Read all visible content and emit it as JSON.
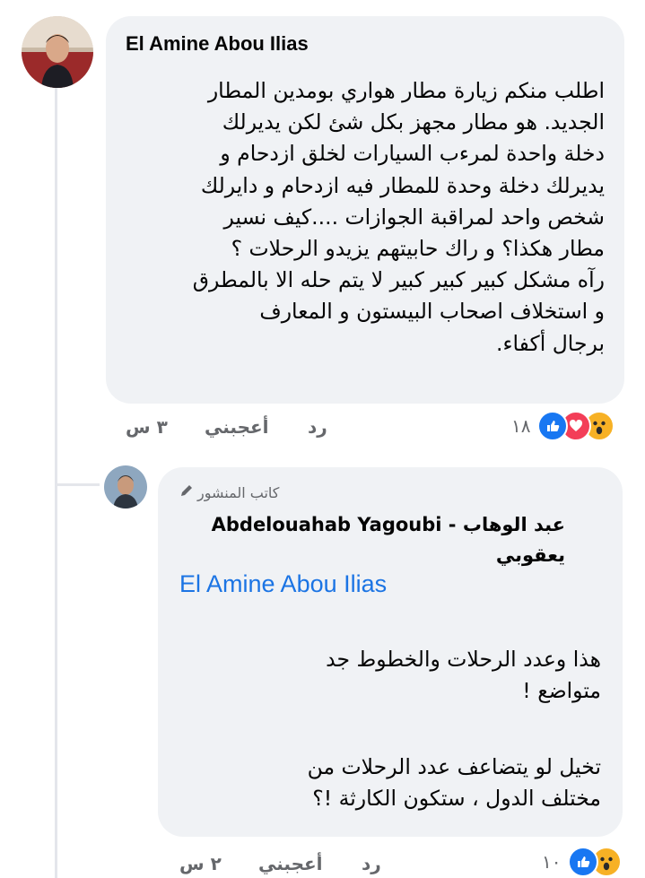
{
  "comment": {
    "author": "El Amine Abou Ilias",
    "text_lines": [
      "اطلب منكم زيارة مطار هواري بومدين المطار",
      "الجديد. هو مطار مجهز بكل شئ لكن يديرلك",
      "دخلة واحدة لمرءب السيارات لخلق ازدحام و",
      "يديرلك دخلة وحدة للمطار فيه ازدحام و دايرلك",
      "شخص واحد لمراقبة الجوازات ....كيف نسير",
      "مطار هكذا؟ و راك حابيتهم يزيدو الرحلات ؟",
      "رآه مشكل كبير كبير كبير لا يتم حله الا بالمطرق",
      "و استخلاف اصحاب البيستون و المعارف",
      "برجال أكفاء."
    ],
    "time": "٣ س",
    "like_label": "أعجبني",
    "reply_label": "رد",
    "reaction_count": "١٨",
    "reactions": [
      "wow-icon",
      "love-icon",
      "like-icon"
    ]
  },
  "reply": {
    "badge": "كاتب المنشور",
    "badge_icon": "pencil-icon",
    "author": "عبد الوهاب - Abdelouahab Yagoubi يعقوبي",
    "mention": "El Amine Abou Ilias",
    "para1_lines": [
      "هذا وعدد الرحلات والخطوط جد",
      "متواضع !"
    ],
    "para2_lines": [
      "تخيل لو يتضاعف عدد الرحلات من",
      "مختلف الدول ،  ستكون الكارثة !؟"
    ],
    "time": "٢ س",
    "like_label": "أعجبني",
    "reply_label": "رد",
    "reaction_count": "١٠",
    "reactions": [
      "wow-icon",
      "like-icon"
    ]
  },
  "colors": {
    "bubble": "#f0f2f5",
    "mention": "#1b74e4",
    "meta": "#65676b",
    "like_blue": "#1877f2",
    "love_red": "#f33e58",
    "wow_yellow": "#f7b125"
  }
}
